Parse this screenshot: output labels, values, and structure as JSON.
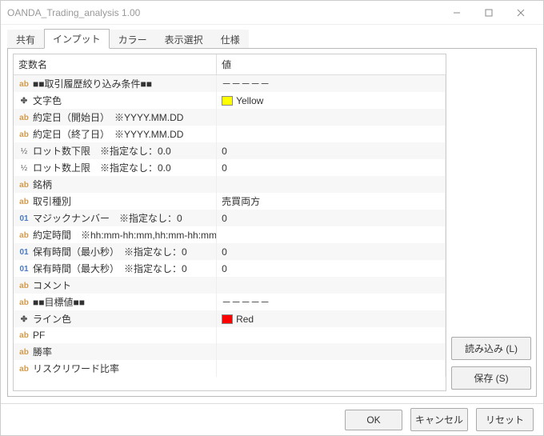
{
  "window": {
    "title": "OANDA_Trading_analysis 1.00"
  },
  "tabs": {
    "t0": "共有",
    "t1": "インプット",
    "t2": "カラー",
    "t3": "表示選択",
    "t4": "仕様",
    "active": 1
  },
  "grid": {
    "header_name": "変数名",
    "header_value": "値"
  },
  "rows": [
    {
      "type": "ab",
      "name": "■■取引履歴絞り込み条件■■",
      "value": "－－－－－"
    },
    {
      "type": "color",
      "name": "文字色",
      "value": "Yellow",
      "swatch": "#ffff00"
    },
    {
      "type": "ab",
      "name": "約定日（開始日）　※YYYY.MM.DD",
      "value": ""
    },
    {
      "type": "ab",
      "name": "約定日（終了日）　※YYYY.MM.DD",
      "value": ""
    },
    {
      "type": "half",
      "name": "ロット数下限　※指定なし：0.0",
      "value": "0"
    },
    {
      "type": "half",
      "name": "ロット数上限　※指定なし：0.0",
      "value": "0"
    },
    {
      "type": "ab",
      "name": "銘柄",
      "value": ""
    },
    {
      "type": "ab",
      "name": "取引種別",
      "value": "売買両方"
    },
    {
      "type": "o1",
      "name": "マジックナンバー　※指定なし：0",
      "value": "0"
    },
    {
      "type": "ab",
      "name": "約定時間　※hh:mm-hh:mm,hh:mm-hh:mm",
      "value": ""
    },
    {
      "type": "o1",
      "name": "保有時間（最小秒）　※指定なし：0",
      "value": "0"
    },
    {
      "type": "o1",
      "name": "保有時間（最大秒）　※指定なし：0",
      "value": "0"
    },
    {
      "type": "ab",
      "name": "コメント",
      "value": ""
    },
    {
      "type": "ab",
      "name": "■■目標値■■",
      "value": "－－－－－"
    },
    {
      "type": "color",
      "name": "ライン色",
      "value": "Red",
      "swatch": "#ff0000"
    },
    {
      "type": "ab",
      "name": "PF",
      "value": ""
    },
    {
      "type": "ab",
      "name": "勝率",
      "value": ""
    },
    {
      "type": "ab",
      "name": "リスクリワード比率",
      "value": ""
    }
  ],
  "sidebuttons": {
    "load": "読み込み (L)",
    "save": "保存 (S)"
  },
  "footer": {
    "ok": "OK",
    "cancel": "キャンセル",
    "reset": "リセット"
  }
}
